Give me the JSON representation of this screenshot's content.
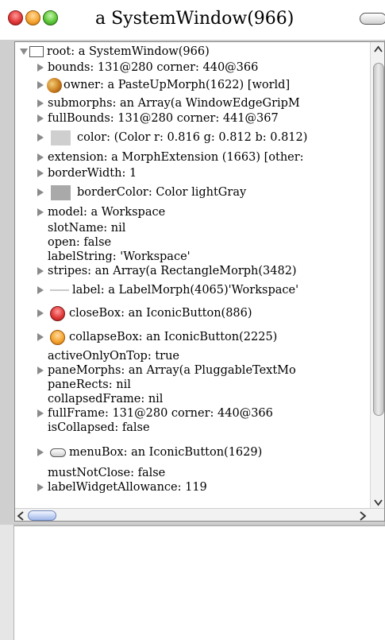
{
  "window": {
    "title": "a SystemWindow(966)"
  },
  "tree": {
    "rows": [
      {
        "text": "root: a SystemWindow(966)"
      },
      {
        "text": "bounds: 131@280 corner: 440@366"
      },
      {
        "text": "owner: a PasteUpMorph(1622) [world]"
      },
      {
        "text": "submorphs: an Array(a WindowEdgeGripM"
      },
      {
        "text": "fullBounds: 131@280 corner: 441@367"
      },
      {
        "text": "color: (Color r: 0.816 g: 0.812 b: 0.812)"
      },
      {
        "text": "extension: a MorphExtension (1663) [other:"
      },
      {
        "text": "borderWidth: 1"
      },
      {
        "text": "borderColor: Color lightGray"
      },
      {
        "text": "model: a Workspace"
      },
      {
        "text": "slotName: nil"
      },
      {
        "text": "open: false"
      },
      {
        "text": "labelString: 'Workspace'"
      },
      {
        "text": "stripes: an Array(a RectangleMorph(3482)"
      },
      {
        "text": "label: a LabelMorph(4065)'Workspace'"
      },
      {
        "text": "closeBox: an IconicButton(886)"
      },
      {
        "text": "collapseBox: an IconicButton(2225)"
      },
      {
        "text": "activeOnlyOnTop: true"
      },
      {
        "text": "paneMorphs: an Array(a PluggableTextMo"
      },
      {
        "text": "paneRects: nil"
      },
      {
        "text": "collapsedFrame: nil"
      },
      {
        "text": "fullFrame: 131@280 corner: 440@366"
      },
      {
        "text": "isCollapsed: false"
      },
      {
        "text": "menuBox: an IconicButton(1629)"
      },
      {
        "text": "mustNotClose: false"
      },
      {
        "text": "labelWidgetAllowance: 119"
      }
    ]
  },
  "colors": {
    "window_bg": "#d0cfcf",
    "swatch_color": "#d0cfcf",
    "swatch_border_color": "#a9a9a9",
    "scroll_thumb_blue": "#9fb7e8"
  },
  "icons": {
    "owner": "world-icon",
    "close": "close-button-icon",
    "collapse": "collapse-button-icon",
    "menu": "menu-button-icon"
  }
}
